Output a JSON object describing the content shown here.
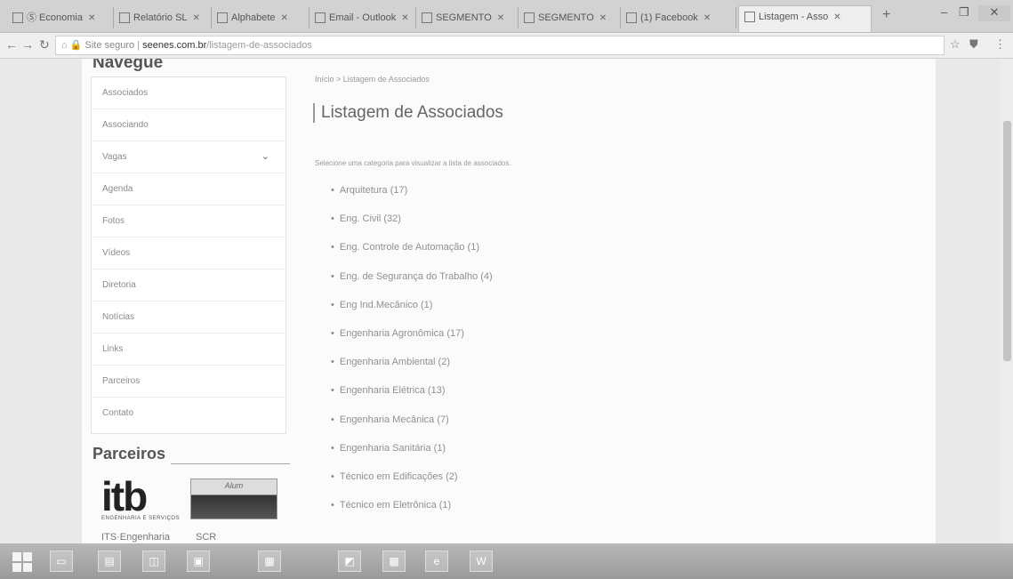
{
  "browser": {
    "tabs": [
      "Ⓢ Economia",
      "Relatório SL",
      "Alphabete",
      "Email - Outlook",
      "SEGMENTO",
      "SEGMENTO",
      "(1) Facebook",
      "Listagem - Asso"
    ],
    "active_tab": 7,
    "url_secure_label": "Site seguro",
    "url_domain": "seenes.com.br",
    "url_path": "/listagem-de-associados"
  },
  "sidebar": {
    "heading": "Navegue",
    "items": [
      {
        "label": "Associados"
      },
      {
        "label": "Associando"
      },
      {
        "label": "Vagas",
        "has_chevron": true
      },
      {
        "label": "Agenda"
      },
      {
        "label": "Fotos"
      },
      {
        "label": "Vídeos"
      },
      {
        "label": "Diretoria"
      },
      {
        "label": "Notícias"
      },
      {
        "label": "Links"
      },
      {
        "label": "Parceiros"
      },
      {
        "label": "Contato"
      }
    ]
  },
  "partners": {
    "heading": "Parceiros",
    "logos": [
      {
        "text": "itb",
        "subtext": "ENGENHARIA E SERVIÇOS"
      },
      {
        "text": "Alum"
      }
    ],
    "more_left": "ITS·Engenharia",
    "more_right": "SCR"
  },
  "main": {
    "breadcrumb": "Início  >  Listagem de Associados",
    "title": "Listagem de Associados",
    "instruction": "Selecione uma categoria para visualizar a lista de associados.",
    "categories": [
      "Arquitetura (17)",
      "Eng. Civil (32)",
      "Eng. Controle de Automação (1)",
      "Eng. de Segurança do Trabalho (4)",
      "Eng Ind.Mecânico (1)",
      "Engenharia Agronômica (17)",
      "Engenharia Ambiental (2)",
      "Engenharia Elétrica (13)",
      "Engenharia Mecânica (7)",
      "Engenharia Sanitária (1)",
      "Técnico em Edificações (2)",
      "Técnico em Eletrônica (1)"
    ]
  }
}
